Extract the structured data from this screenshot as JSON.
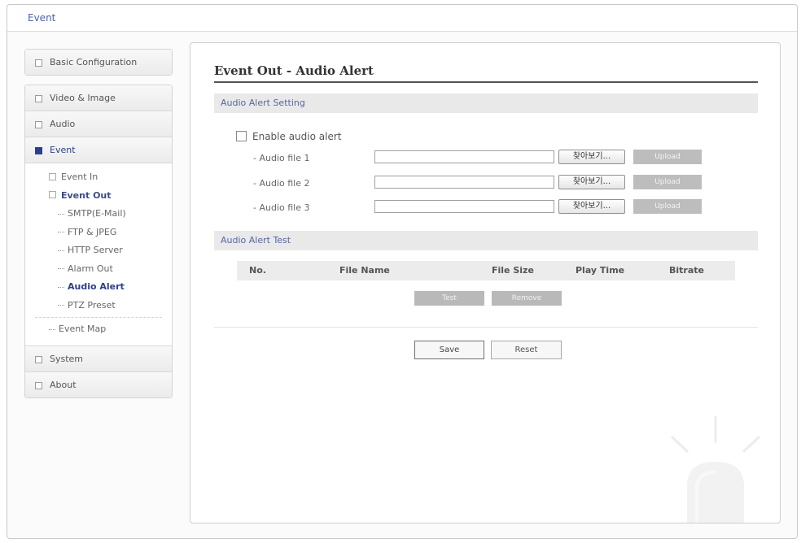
{
  "window": {
    "title": "Event"
  },
  "sidebar": {
    "basic": "Basic Configuration",
    "video": "Video & Image",
    "audio": "Audio",
    "event": "Event",
    "event_sub": {
      "event_in": "Event In",
      "event_out": "Event Out",
      "items": [
        "SMTP(E-Mail)",
        "FTP & JPEG",
        "HTTP Server",
        "Alarm Out",
        "Audio Alert",
        "PTZ Preset"
      ],
      "event_map": "Event Map"
    },
    "system": "System",
    "about": "About"
  },
  "main": {
    "title": "Event Out - Audio Alert",
    "setting_section": "Audio Alert Setting",
    "enable_label": "Enable audio alert",
    "enable_checked": false,
    "files": [
      {
        "label": "- Audio file 1",
        "value": "",
        "browse": "찾아보기...",
        "upload": "Upload"
      },
      {
        "label": "- Audio file 2",
        "value": "",
        "browse": "찾아보기...",
        "upload": "Upload"
      },
      {
        "label": "- Audio file 3",
        "value": "",
        "browse": "찾아보기...",
        "upload": "Upload"
      }
    ],
    "test_section": "Audio Alert Test",
    "table_headers": [
      "No.",
      "File Name",
      "File Size",
      "Play Time",
      "Bitrate"
    ],
    "test_button": "Test",
    "remove_button": "Remove",
    "save_button": "Save",
    "reset_button": "Reset"
  },
  "colors": {
    "accent": "#2d3f8a",
    "link": "#5566a2",
    "disabled_button": "#bdbdbd"
  }
}
